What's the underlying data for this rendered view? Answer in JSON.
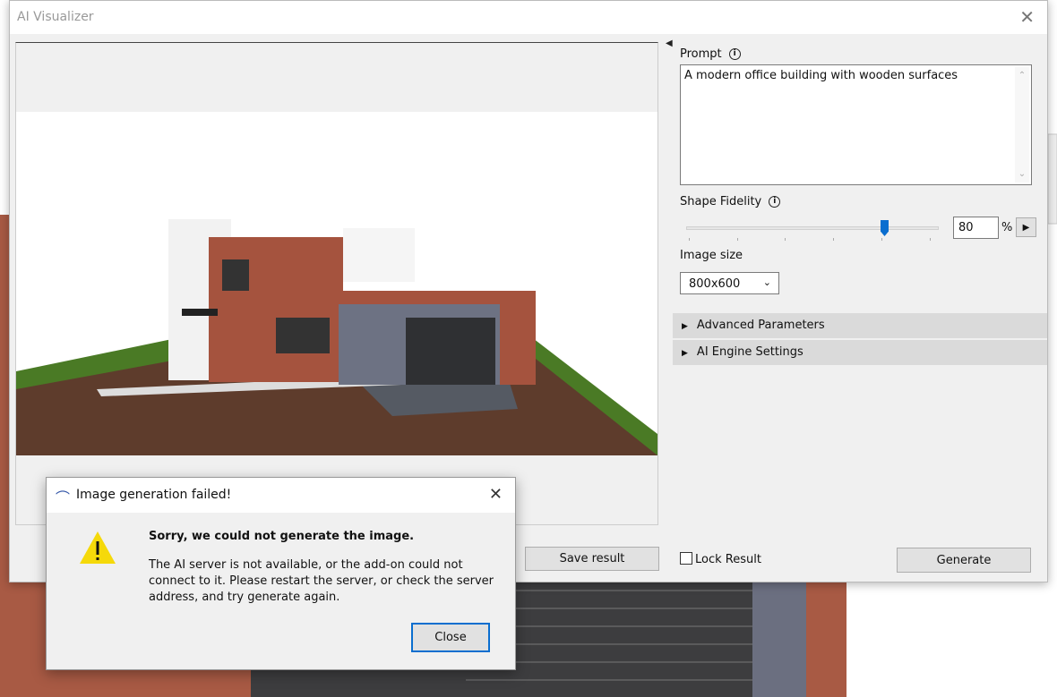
{
  "window": {
    "title": "AI Visualizer"
  },
  "left": {
    "save_label": "Save result"
  },
  "right": {
    "prompt_label": "Prompt",
    "prompt_value": "A modern office building with wooden surfaces",
    "fidelity_label": "Shape Fidelity",
    "fidelity_value": "80",
    "fidelity_unit": "%",
    "fidelity_percent": 80,
    "image_size_label": "Image size",
    "image_size_value": "800x600",
    "sections": [
      "Advanced Parameters",
      "AI Engine Settings"
    ],
    "lock_label": "Lock Result",
    "generate_label": "Generate"
  },
  "dialog": {
    "title": "Image generation failed!",
    "heading": "Sorry, we could not generate the image.",
    "body": "The AI server is not available, or the add-on could not connect to it. Please restart the server, or check the server address, and try generate again.",
    "close_label": "Close"
  },
  "colors": {
    "accent": "#0a6ecf",
    "warning": "#f5d90a"
  }
}
